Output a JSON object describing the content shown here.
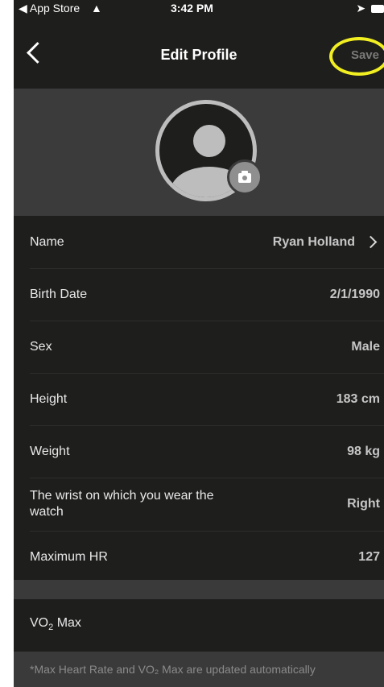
{
  "status_bar": {
    "back_app": "◀ App Store",
    "time": "3:42 PM"
  },
  "nav": {
    "title": "Edit Profile",
    "save_label": "Save",
    "highlight_color": "#f1ee22"
  },
  "profile_rows": [
    {
      "label": "Name",
      "value": "Ryan Holland"
    },
    {
      "label": "Birth Date",
      "value": "2/1/1990"
    },
    {
      "label": "Sex",
      "value": "Male"
    },
    {
      "label": "Height",
      "value": "183 cm"
    },
    {
      "label": "Weight",
      "value": "98 kg"
    },
    {
      "label": "The wrist on which you wear the watch",
      "value": "Right"
    },
    {
      "label": "Maximum HR",
      "value": "127"
    }
  ],
  "vo2": {
    "label_main": "VO",
    "label_sub": "2",
    "label_tail": " Max"
  },
  "footer": {
    "note": "*Max Heart Rate and VO₂ Max are updated automatically"
  }
}
